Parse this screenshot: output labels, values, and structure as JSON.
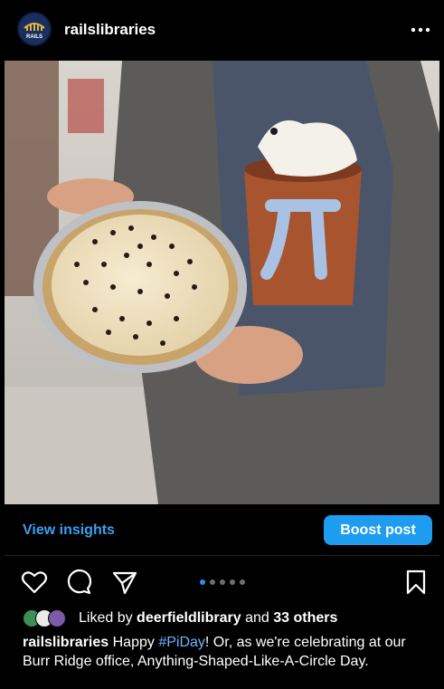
{
  "post": {
    "username": "railslibraries",
    "avatar_text": "RAILS",
    "more_icon": "more-horizontal-icon"
  },
  "image": {
    "description_icon": "photo"
  },
  "insights": {
    "view_label": "View insights",
    "boost_label": "Boost post"
  },
  "actions": {
    "icons": [
      "heart-icon",
      "comment-icon",
      "share-icon",
      "bookmark-icon"
    ],
    "carousel_count": 5,
    "carousel_active": 0
  },
  "likes": {
    "prefix": "Liked by",
    "user": "deerfieldlibrary",
    "and": "and",
    "others": "33 others"
  },
  "caption": {
    "username": "railslibraries",
    "text_before": "Happy ",
    "hashtag": "#PiDay",
    "text_after": "! Or, as we're celebrating at our Burr Ridge office, Anything-Shaped-Like-A-Circle Day."
  },
  "colors": {
    "background": "#000000",
    "accent": "#1e9cf0",
    "link": "#3aa0f3"
  }
}
